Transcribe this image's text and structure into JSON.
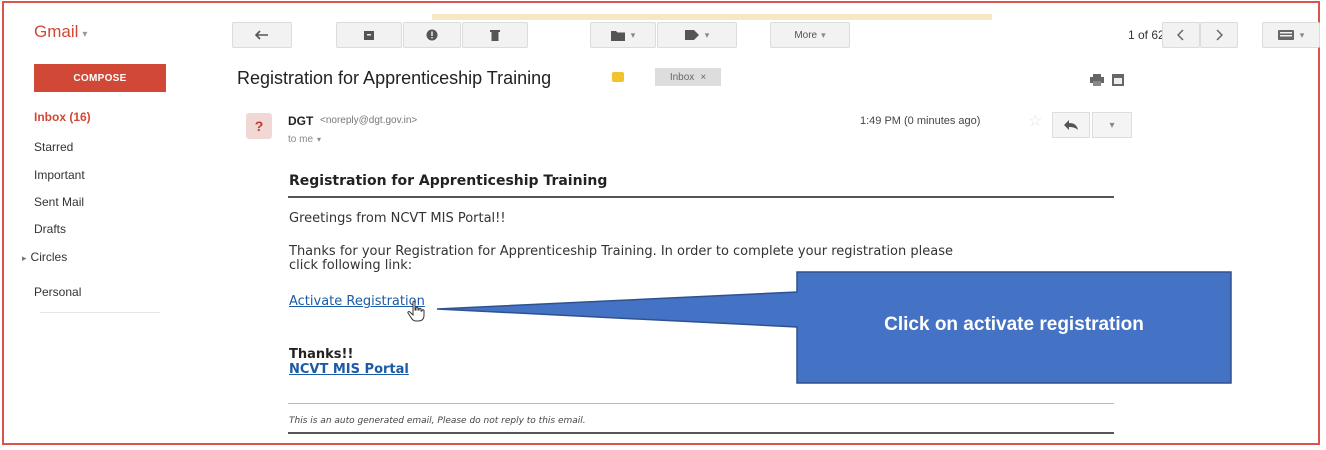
{
  "app": {
    "name": "Gmail"
  },
  "toolbar": {
    "more_label": "More",
    "pager": {
      "text": "1 of 62"
    }
  },
  "sidebar": {
    "compose_label": "COMPOSE",
    "items": [
      {
        "label": "Inbox (16)"
      },
      {
        "label": "Starred"
      },
      {
        "label": "Important"
      },
      {
        "label": "Sent Mail"
      },
      {
        "label": "Drafts"
      },
      {
        "label": "Circles"
      },
      {
        "label": "Personal"
      }
    ]
  },
  "email": {
    "subject": "Registration for Apprenticeship Training",
    "label_badge": "Inbox",
    "sender_name": "DGT",
    "sender_email": "<noreply@dgt.gov.in>",
    "to": "to me",
    "time": "1:49 PM (0 minutes ago)",
    "avatar_letter": "?",
    "body": {
      "heading": "Registration for Apprenticeship Training",
      "greeting": "Greetings from NCVT MIS Portal!!",
      "para_line1": "Thanks for your Registration for Apprenticeship Training. In order to complete your registration please",
      "para_line2": "click following link:",
      "activate_link": "Activate Registration",
      "thanks": "Thanks!!",
      "portal_link": "NCVT MIS Portal",
      "footer": "This is an auto generated email, Please do not reply to this email."
    }
  },
  "callout": {
    "text": "Click on activate registration",
    "color": "#4472c4"
  },
  "colors": {
    "accent": "#d14836",
    "link": "#1a5aa6",
    "frame": "#d9534f"
  }
}
